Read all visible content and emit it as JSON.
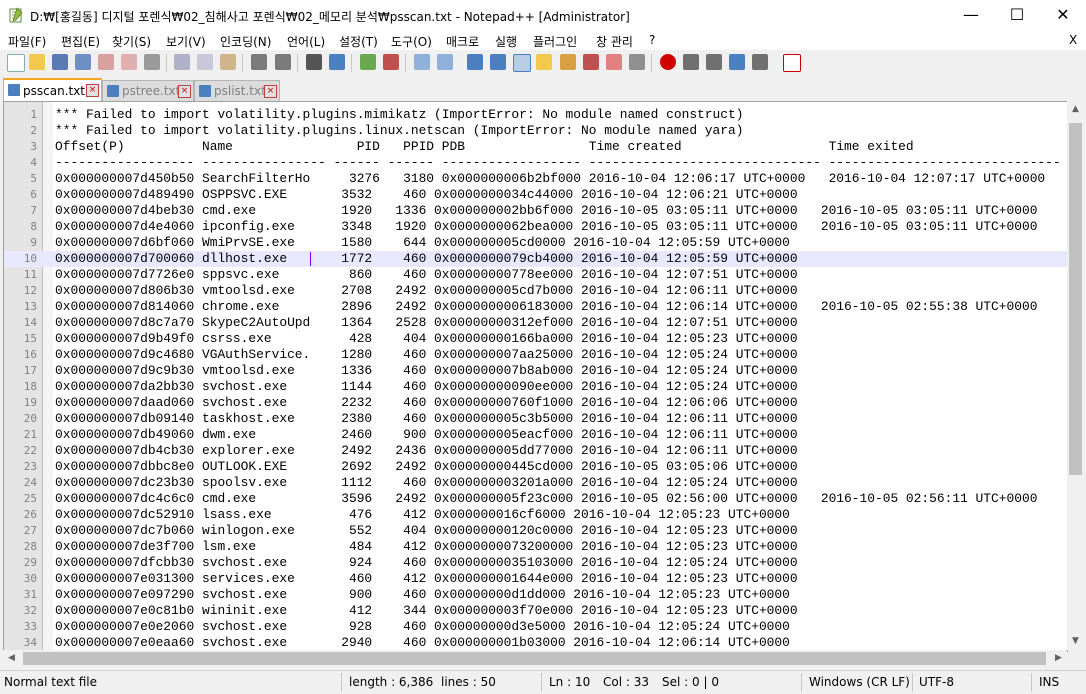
{
  "window": {
    "title": "D:₩[홍길동] 디지털 포렌식₩02_침해사고 포렌식₩02_메모리 분석₩psscan.txt - Notepad++ [Administrator]",
    "minimize_symbol": "—",
    "maximize_symbol": "☐",
    "close_symbol": "✕"
  },
  "menu": {
    "items": [
      "파일(F)",
      "편집(E)",
      "찾기(S)",
      "보기(V)",
      "인코딩(N)",
      "언어(L)",
      "설정(T)",
      "도구(O)",
      "매크로",
      "실행",
      "플러그인",
      "창 관리",
      "?"
    ],
    "close_symbol": "X"
  },
  "toolbar": {
    "icons": [
      "new-file-icon",
      "open-file-icon",
      "save-icon",
      "save-all-icon",
      "close-icon",
      "close-all-icon",
      "print-icon",
      "cut-icon",
      "copy-icon",
      "paste-icon",
      "undo-icon",
      "redo-icon",
      "find-icon",
      "replace-icon",
      "zoom-in-icon",
      "zoom-out-icon",
      "sync-vertical-icon",
      "sync-horizontal-icon",
      "word-wrap-icon",
      "show-all-chars-icon",
      "indent-guide-icon",
      "document-map-icon",
      "function-list-icon",
      "folder-workspace-icon",
      "document-list-icon",
      "monitoring-icon",
      "record-macro-icon",
      "stop-macro-icon",
      "play-macro-icon",
      "run-macro-multiple-icon",
      "save-macro-icon",
      "spell-check-icon"
    ]
  },
  "tabs": [
    {
      "label": "psscan.txt",
      "active": true
    },
    {
      "label": "pstree.txt",
      "active": false
    },
    {
      "label": "pslist.txt",
      "active": false
    }
  ],
  "editor": {
    "current_line": 10,
    "lines": [
      "*** Failed to import volatility.plugins.mimikatz (ImportError: No module named construct)",
      "*** Failed to import volatility.plugins.linux.netscan (ImportError: No module named yara)",
      "Offset(P)          Name                PID   PPID PDB                Time created                   Time exited",
      "------------------ ---------------- ------ ------ ------------------ ------------------------------ ------------------------------",
      "0x000000007d450b50 SearchFilterHo     3276   3180 0x000000006b2bf000 2016-10-04 12:06:17 UTC+0000   2016-10-04 12:07:17 UTC+0000",
      "0x000000007d489490 OSPPSVC.EXE       3532    460 0x0000000034c44000 2016-10-04 12:06:21 UTC+0000",
      "0x000000007d4beb30 cmd.exe           1920   1336 0x000000002bb6f000 2016-10-05 03:05:11 UTC+0000   2016-10-05 03:05:11 UTC+0000",
      "0x000000007d4e4060 ipconfig.exe      3348   1920 0x0000000062bea000 2016-10-05 03:05:11 UTC+0000   2016-10-05 03:05:11 UTC+0000",
      "0x000000007d6bf060 WmiPrvSE.exe      1580    644 0x000000005cd0000 2016-10-04 12:05:59 UTC+0000",
      "0x000000007d700060 dllhost.exe       1772    460 0x0000000079cb4000 2016-10-04 12:05:59 UTC+0000",
      "0x000000007d7726e0 sppsvc.exe         860    460 0x00000000778ee000 2016-10-04 12:07:51 UTC+0000",
      "0x000000007d806b30 vmtoolsd.exe      2708   2492 0x000000005cd7b000 2016-10-04 12:06:11 UTC+0000",
      "0x000000007d814060 chrome.exe        2896   2492 0x0000000006183000 2016-10-04 12:06:14 UTC+0000   2016-10-05 02:55:38 UTC+0000",
      "0x000000007d8c7a70 SkypeC2AutoUpd    1364   2528 0x00000000312ef000 2016-10-04 12:07:51 UTC+0000",
      "0x000000007d9b49f0 csrss.exe          428    404 0x00000000166ba000 2016-10-04 12:05:23 UTC+0000",
      "0x000000007d9c4680 VGAuthService.    1280    460 0x000000007aa25000 2016-10-04 12:05:24 UTC+0000",
      "0x000000007d9c9b30 vmtoolsd.exe      1336    460 0x000000007b8ab000 2016-10-04 12:05:24 UTC+0000",
      "0x000000007da2bb30 svchost.exe       1144    460 0x00000000090ee000 2016-10-04 12:05:24 UTC+0000",
      "0x000000007daad060 svchost.exe       2232    460 0x00000000760f1000 2016-10-04 12:06:06 UTC+0000",
      "0x000000007db09140 taskhost.exe      2380    460 0x000000005c3b5000 2016-10-04 12:06:11 UTC+0000",
      "0x000000007db49060 dwm.exe           2460    900 0x000000005eacf000 2016-10-04 12:06:11 UTC+0000",
      "0x000000007db4cb30 explorer.exe      2492   2436 0x000000005dd77000 2016-10-04 12:06:11 UTC+0000",
      "0x000000007dbbc8e0 OUTLOOK.EXE       2692   2492 0x00000000445cd000 2016-10-05 03:05:06 UTC+0000",
      "0x000000007dc23b30 spoolsv.exe       1112    460 0x000000003201a000 2016-10-04 12:05:24 UTC+0000",
      "0x000000007dc4c6c0 cmd.exe           3596   2492 0x000000005f23c000 2016-10-05 02:56:00 UTC+0000   2016-10-05 02:56:11 UTC+0000",
      "0x000000007dc52910 lsass.exe          476    412 0x000000016cf6000 2016-10-04 12:05:23 UTC+0000",
      "0x000000007dc7b060 winlogon.exe       552    404 0x00000000120c0000 2016-10-04 12:05:23 UTC+0000",
      "0x000000007de3f700 lsm.exe            484    412 0x0000000073200000 2016-10-04 12:05:23 UTC+0000",
      "0x000000007dfcbb30 svchost.exe        924    460 0x0000000035103000 2016-10-04 12:05:24 UTC+0000",
      "0x000000007e031300 services.exe       460    412 0x000000001644e000 2016-10-04 12:05:23 UTC+0000",
      "0x000000007e097290 svchost.exe        900    460 0x00000000d1dd000 2016-10-04 12:05:23 UTC+0000",
      "0x000000007e0c81b0 wininit.exe        412    344 0x000000003f70e000 2016-10-04 12:05:23 UTC+0000",
      "0x000000007e0e2060 svchost.exe        928    460 0x00000000d3e5000 2016-10-04 12:05:24 UTC+0000",
      "0x000000007e0eaa60 svchost.exe       2940    460 0x000000001b03000 2016-10-04 12:06:14 UTC+0000"
    ]
  },
  "statusbar": {
    "file_type": "Normal text file",
    "length": "length : 6,386",
    "lines": "lines : 50",
    "ln": "Ln : 10",
    "col": "Col : 33",
    "sel": "Sel : 0 | 0",
    "eol": "Windows (CR LF)",
    "encoding": "UTF-8",
    "mode": "INS"
  },
  "colors": {
    "current_line": "#e8e8ff",
    "caret": "#8000ff",
    "active_tab_accent": "#f5a623"
  }
}
